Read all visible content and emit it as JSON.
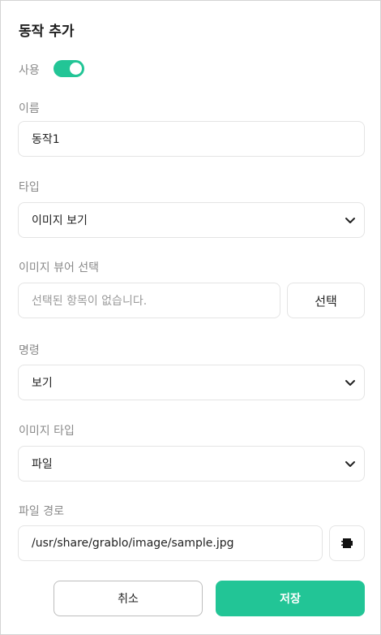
{
  "dialog": {
    "title": "동작 추가"
  },
  "enabled": {
    "label": "사용",
    "value": true
  },
  "name": {
    "label": "이름",
    "value": "동작1"
  },
  "type": {
    "label": "타입",
    "value": "이미지 보기"
  },
  "viewer": {
    "label": "이미지 뷰어 선택",
    "placeholder": "선택된 항목이 없습니다.",
    "select_label": "선택"
  },
  "command": {
    "label": "명령",
    "value": "보기"
  },
  "image_type": {
    "label": "이미지 타입",
    "value": "파일"
  },
  "file_path": {
    "label": "파일 경로",
    "value": "/usr/share/grablo/image/sample.jpg",
    "icon": "puzzle-piece-icon"
  },
  "footer": {
    "cancel_label": "취소",
    "save_label": "저장"
  },
  "colors": {
    "accent": "#22c596",
    "border": "#e4e4e4",
    "label": "#8a8a8a"
  }
}
